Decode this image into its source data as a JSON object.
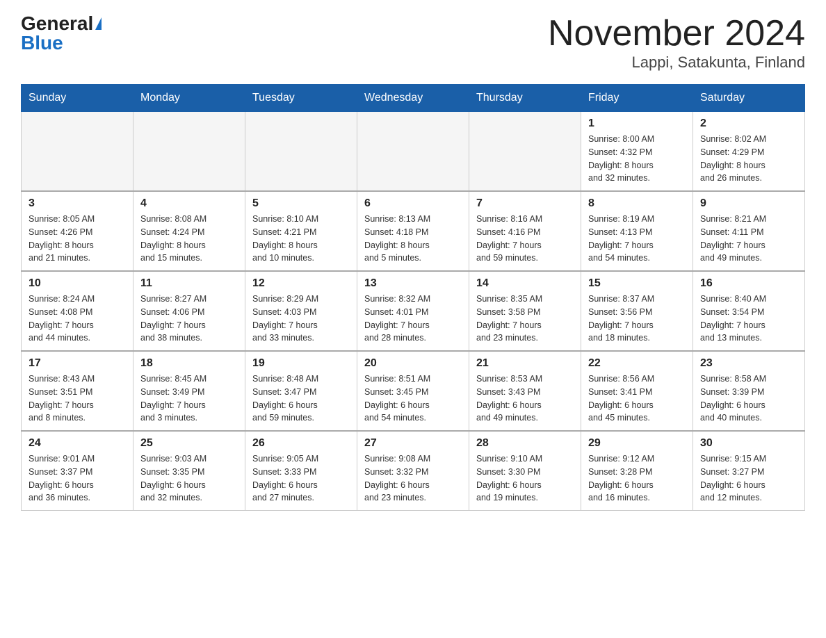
{
  "logo": {
    "general": "General",
    "blue": "Blue"
  },
  "title": "November 2024",
  "subtitle": "Lappi, Satakunta, Finland",
  "days_of_week": [
    "Sunday",
    "Monday",
    "Tuesday",
    "Wednesday",
    "Thursday",
    "Friday",
    "Saturday"
  ],
  "weeks": [
    {
      "days": [
        {
          "num": "",
          "info": ""
        },
        {
          "num": "",
          "info": ""
        },
        {
          "num": "",
          "info": ""
        },
        {
          "num": "",
          "info": ""
        },
        {
          "num": "",
          "info": ""
        },
        {
          "num": "1",
          "info": "Sunrise: 8:00 AM\nSunset: 4:32 PM\nDaylight: 8 hours\nand 32 minutes."
        },
        {
          "num": "2",
          "info": "Sunrise: 8:02 AM\nSunset: 4:29 PM\nDaylight: 8 hours\nand 26 minutes."
        }
      ]
    },
    {
      "days": [
        {
          "num": "3",
          "info": "Sunrise: 8:05 AM\nSunset: 4:26 PM\nDaylight: 8 hours\nand 21 minutes."
        },
        {
          "num": "4",
          "info": "Sunrise: 8:08 AM\nSunset: 4:24 PM\nDaylight: 8 hours\nand 15 minutes."
        },
        {
          "num": "5",
          "info": "Sunrise: 8:10 AM\nSunset: 4:21 PM\nDaylight: 8 hours\nand 10 minutes."
        },
        {
          "num": "6",
          "info": "Sunrise: 8:13 AM\nSunset: 4:18 PM\nDaylight: 8 hours\nand 5 minutes."
        },
        {
          "num": "7",
          "info": "Sunrise: 8:16 AM\nSunset: 4:16 PM\nDaylight: 7 hours\nand 59 minutes."
        },
        {
          "num": "8",
          "info": "Sunrise: 8:19 AM\nSunset: 4:13 PM\nDaylight: 7 hours\nand 54 minutes."
        },
        {
          "num": "9",
          "info": "Sunrise: 8:21 AM\nSunset: 4:11 PM\nDaylight: 7 hours\nand 49 minutes."
        }
      ]
    },
    {
      "days": [
        {
          "num": "10",
          "info": "Sunrise: 8:24 AM\nSunset: 4:08 PM\nDaylight: 7 hours\nand 44 minutes."
        },
        {
          "num": "11",
          "info": "Sunrise: 8:27 AM\nSunset: 4:06 PM\nDaylight: 7 hours\nand 38 minutes."
        },
        {
          "num": "12",
          "info": "Sunrise: 8:29 AM\nSunset: 4:03 PM\nDaylight: 7 hours\nand 33 minutes."
        },
        {
          "num": "13",
          "info": "Sunrise: 8:32 AM\nSunset: 4:01 PM\nDaylight: 7 hours\nand 28 minutes."
        },
        {
          "num": "14",
          "info": "Sunrise: 8:35 AM\nSunset: 3:58 PM\nDaylight: 7 hours\nand 23 minutes."
        },
        {
          "num": "15",
          "info": "Sunrise: 8:37 AM\nSunset: 3:56 PM\nDaylight: 7 hours\nand 18 minutes."
        },
        {
          "num": "16",
          "info": "Sunrise: 8:40 AM\nSunset: 3:54 PM\nDaylight: 7 hours\nand 13 minutes."
        }
      ]
    },
    {
      "days": [
        {
          "num": "17",
          "info": "Sunrise: 8:43 AM\nSunset: 3:51 PM\nDaylight: 7 hours\nand 8 minutes."
        },
        {
          "num": "18",
          "info": "Sunrise: 8:45 AM\nSunset: 3:49 PM\nDaylight: 7 hours\nand 3 minutes."
        },
        {
          "num": "19",
          "info": "Sunrise: 8:48 AM\nSunset: 3:47 PM\nDaylight: 6 hours\nand 59 minutes."
        },
        {
          "num": "20",
          "info": "Sunrise: 8:51 AM\nSunset: 3:45 PM\nDaylight: 6 hours\nand 54 minutes."
        },
        {
          "num": "21",
          "info": "Sunrise: 8:53 AM\nSunset: 3:43 PM\nDaylight: 6 hours\nand 49 minutes."
        },
        {
          "num": "22",
          "info": "Sunrise: 8:56 AM\nSunset: 3:41 PM\nDaylight: 6 hours\nand 45 minutes."
        },
        {
          "num": "23",
          "info": "Sunrise: 8:58 AM\nSunset: 3:39 PM\nDaylight: 6 hours\nand 40 minutes."
        }
      ]
    },
    {
      "days": [
        {
          "num": "24",
          "info": "Sunrise: 9:01 AM\nSunset: 3:37 PM\nDaylight: 6 hours\nand 36 minutes."
        },
        {
          "num": "25",
          "info": "Sunrise: 9:03 AM\nSunset: 3:35 PM\nDaylight: 6 hours\nand 32 minutes."
        },
        {
          "num": "26",
          "info": "Sunrise: 9:05 AM\nSunset: 3:33 PM\nDaylight: 6 hours\nand 27 minutes."
        },
        {
          "num": "27",
          "info": "Sunrise: 9:08 AM\nSunset: 3:32 PM\nDaylight: 6 hours\nand 23 minutes."
        },
        {
          "num": "28",
          "info": "Sunrise: 9:10 AM\nSunset: 3:30 PM\nDaylight: 6 hours\nand 19 minutes."
        },
        {
          "num": "29",
          "info": "Sunrise: 9:12 AM\nSunset: 3:28 PM\nDaylight: 6 hours\nand 16 minutes."
        },
        {
          "num": "30",
          "info": "Sunrise: 9:15 AM\nSunset: 3:27 PM\nDaylight: 6 hours\nand 12 minutes."
        }
      ]
    }
  ]
}
